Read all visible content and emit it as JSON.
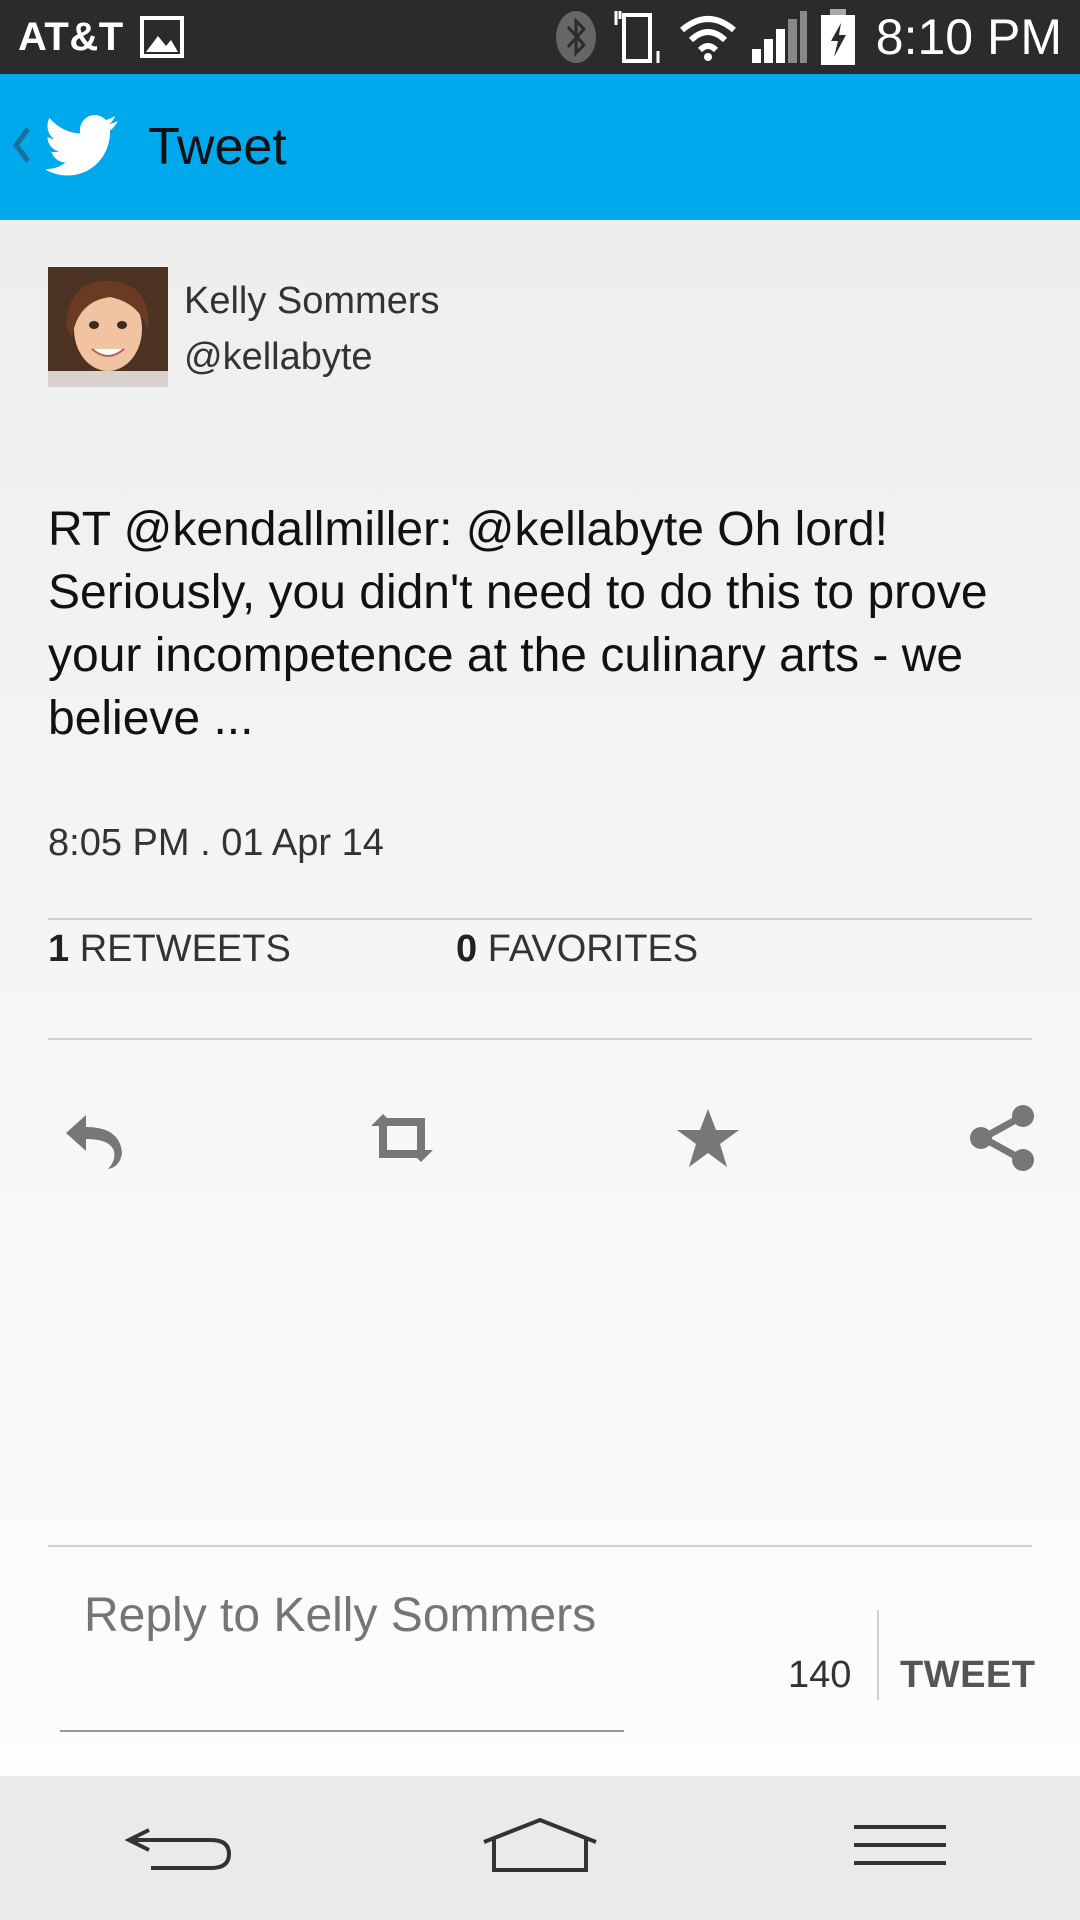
{
  "status_bar": {
    "carrier": "AT&T",
    "time": "8:10 PM",
    "icons": [
      "image-icon",
      "bluetooth-icon",
      "vibrate-icon",
      "wifi-icon",
      "signal-icon",
      "battery-charging-icon"
    ]
  },
  "app_bar": {
    "title": "Tweet",
    "brand_color": "#00a9eb"
  },
  "tweet": {
    "author_name": "Kelly Sommers",
    "author_handle": "@kellabyte",
    "text": "RT @kendallmiller: @kellabyte Oh lord! Seriously, you didn't need to do this to prove your incompetence at the culinary arts - we believe ...",
    "timestamp": "8:05 PM . 01 Apr 14",
    "retweets_count": "1",
    "retweets_label": "RETWEETS",
    "favorites_count": "0",
    "favorites_label": "FAVORITES"
  },
  "actions": [
    "reply-icon",
    "retweet-icon",
    "favorite-star-icon",
    "share-icon"
  ],
  "reply": {
    "placeholder": "Reply to Kelly Sommers",
    "char_count": "140",
    "tweet_button": "TWEET"
  },
  "nav_bar": [
    "back-icon",
    "home-icon",
    "menu-icon"
  ]
}
